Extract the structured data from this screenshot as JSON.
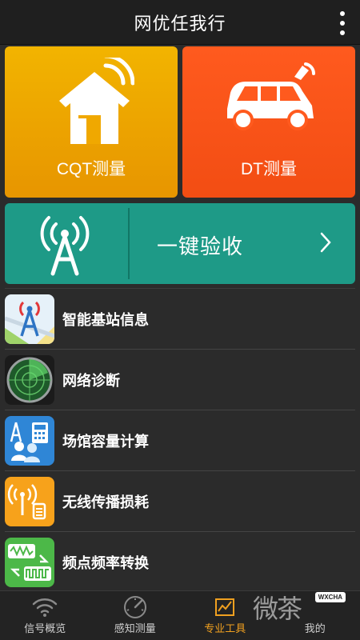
{
  "header": {
    "title": "网优任我行"
  },
  "tiles": {
    "cqt_label": "CQT测量",
    "dt_label": "DT测量"
  },
  "accept": {
    "label": "一键验收"
  },
  "list": [
    {
      "label": "智能基站信息",
      "icon": "tower-map-icon"
    },
    {
      "label": "网络诊断",
      "icon": "radar-icon"
    },
    {
      "label": "场馆容量计算",
      "icon": "venue-capacity-icon"
    },
    {
      "label": "无线传播损耗",
      "icon": "wireless-loss-icon"
    },
    {
      "label": "频点频率转换",
      "icon": "frequency-convert-icon"
    }
  ],
  "tabs": [
    {
      "label": "信号概览",
      "icon": "wifi-icon",
      "active": false
    },
    {
      "label": "感知测量",
      "icon": "gauge-icon",
      "active": false
    },
    {
      "label": "专业工具",
      "icon": "chart-tool-icon",
      "active": true
    },
    {
      "label": "我的",
      "icon": "profile-icon",
      "active": false
    }
  ],
  "watermark": {
    "text": "微茶",
    "badge": "WXCHA"
  },
  "colors": {
    "cqt": "#f2b400",
    "dt": "#ff5a1e",
    "accept": "#1e9a87",
    "active_tab": "#f0a020"
  }
}
